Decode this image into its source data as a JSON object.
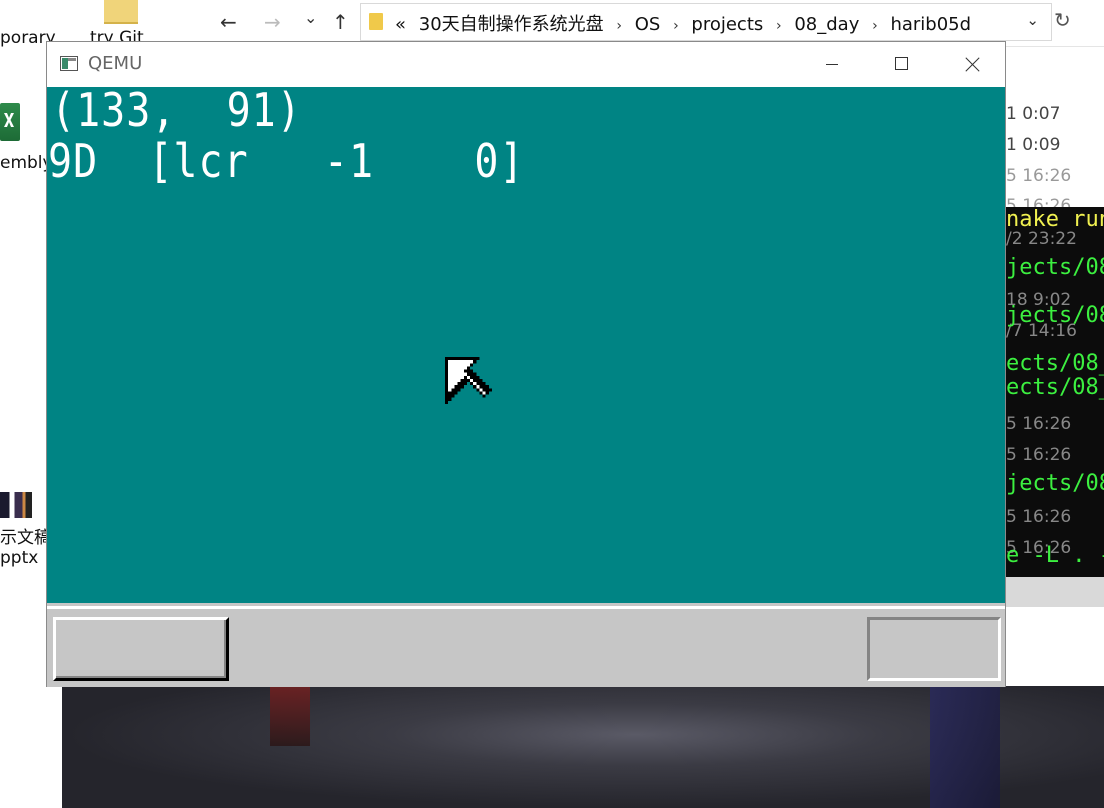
{
  "desktop": {
    "labels": [
      "porary",
      "try Git",
      "embly",
      "示文稿",
      "pptx"
    ]
  },
  "explorer": {
    "back": "←",
    "forward": "→",
    "recent": "⌄",
    "up": "↑",
    "breadcrumb_prefix": "«",
    "path": [
      "30天自制操作系统光盘",
      "OS",
      "projects",
      "08_day",
      "harib05d"
    ],
    "separator": "›",
    "dropdown": "⌄",
    "refresh": "↻",
    "file_dates": [
      "1 0:07",
      "1 0:09",
      "5 16:26",
      "5 16:26",
      "/2 23:22",
      "18 9:02",
      "/7 14:16",
      "5 16:26",
      "5 16:26",
      "5 16:26",
      "5 16:26",
      "5 16:26"
    ]
  },
  "terminal": {
    "lines": [
      {
        "text": "nake run",
        "color": "yellow"
      },
      {
        "text": "jects/08_",
        "color": "green"
      },
      {
        "text": "jects/08_",
        "color": "green"
      },
      {
        "text": "ects/08_",
        "color": "green"
      },
      {
        "text": "ects/08_",
        "color": "green"
      },
      {
        "text": "jects/08_",
        "color": "green"
      },
      {
        "text": "e -L . -",
        "color": "green"
      }
    ]
  },
  "qemu": {
    "title": "QEMU",
    "screen": {
      "line1": "(133,  91)",
      "line2": "9D  [lcr   -1    0]",
      "background": "#008484",
      "text_color": "#ffffff"
    },
    "taskbar_color": "#c6c6c6"
  }
}
